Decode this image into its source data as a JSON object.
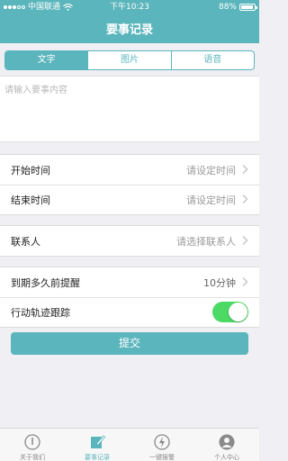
{
  "status_bar": {
    "carrier": "中国联通",
    "time": "下午10:23",
    "battery": "88%"
  },
  "nav": {
    "title": "要事记录"
  },
  "segments": [
    {
      "label": "文字",
      "active": true
    },
    {
      "label": "图片",
      "active": false
    },
    {
      "label": "语音",
      "active": false
    }
  ],
  "content": {
    "placeholder": "请输入要事内容",
    "value": ""
  },
  "rows": {
    "start_time": {
      "label": "开始时间",
      "value": "请设定时间"
    },
    "end_time": {
      "label": "结束时间",
      "value": "请设定时间"
    },
    "contact": {
      "label": "联系人",
      "value": "请选择联系人"
    },
    "reminder": {
      "label": "到期多久前提醒",
      "value": "10分钟"
    },
    "tracking": {
      "label": "行动轨迹跟踪",
      "enabled": true
    }
  },
  "submit_label": "提交",
  "tabbar": [
    {
      "label": "关于我们",
      "icon": "info-icon",
      "active": false
    },
    {
      "label": "要事记录",
      "icon": "edit-icon",
      "active": true
    },
    {
      "label": "一键报警",
      "icon": "alarm-icon",
      "active": false
    },
    {
      "label": "个人中心",
      "icon": "person-icon",
      "active": false
    }
  ],
  "colors": {
    "accent": "#5bb5bc",
    "toggle_on": "#4cd964",
    "background": "#efeff4"
  }
}
